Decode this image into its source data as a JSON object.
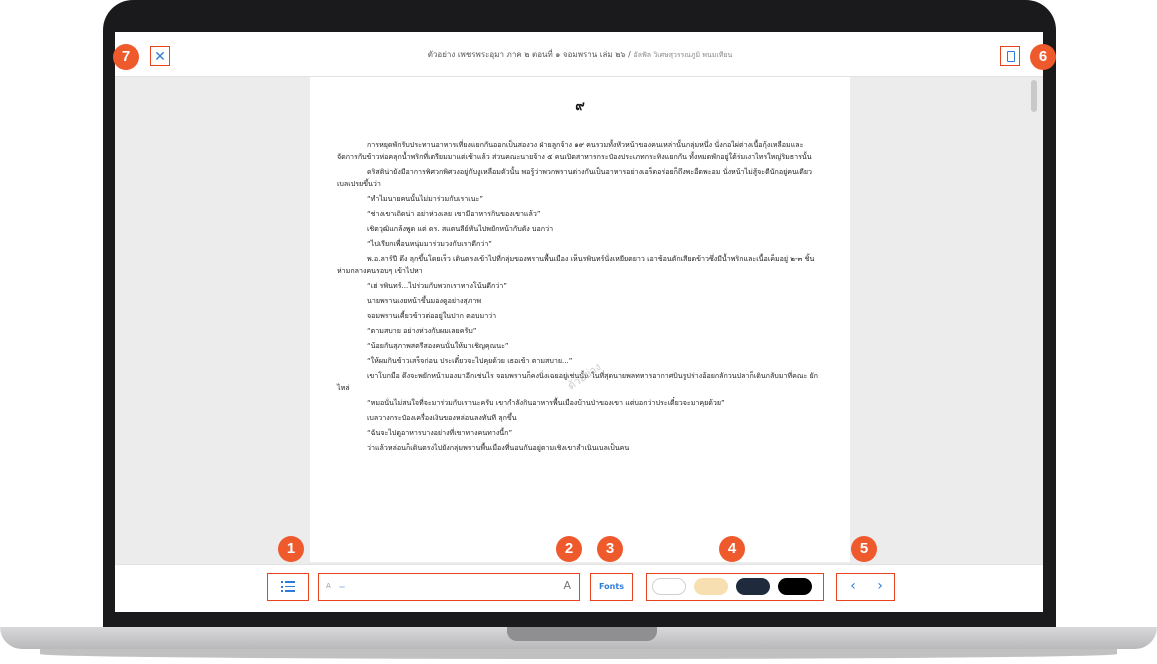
{
  "header": {
    "title": "ตัวอย่าง เพชรพระอุมา ภาค ๒ ตอนที่ ๑ จอมพราน เล่ม ๒๖ /",
    "author": "อัลฟัล วิเศษสุวรรณภูมิ พนมเทียน",
    "close_icon": "close-icon",
    "bookmark_icon": "bookmark-icon"
  },
  "page": {
    "number": "๙",
    "watermark": "ตัวอย่าง",
    "paragraphs": [
      "การหยุดพักรับประทานอาหารเที่ยงแยกกันออกเป็นสองวง ฝ่ายลูกจ้าง ๑๙ คนรวมทั้งหัวหน้าของคนเหล่านั้นกลุ่มหนึ่ง นั่งกอไผ่ต่างเนื้อกุ้งเหลือมและจัดการกับข้าวห่อคลุกน้ำพริกที่เตรียมมาแต่เช้าแล้ว ส่วนคณะนายจ้าง ๕ คนเปิดสาหารกระป๋องประเภทกระทิงแยกกัน ทั้งหมดพักอยู่ใต้ร่มเงาไทรใหญ่ริมธารนั้น",
      "ดริสติน่ายังมีอาการพิศวกพิศวงอยู่กับงูเหลือมตัวนั้น พอรู้ว่าพวกพรานต่างกันเป็นอาหารอย่างเอร็ดอร่อยก็ถึงพะอืดพะอม นั่งหน้าไม่สู้จะดีนักอยู่คนเดียว เบลเปรยขึ้นว่า",
      "“ทำไมนายคนนั้นไม่มาร่วมกับเราเนะ”",
      "“ช่างเขาเถิดน่า อย่าห่วงเลย เขามีอาหารกินของเขาแล้ว”",
      "เชิดวุฒิแกล้งพูด แต่ ดร. สแตนลีย์หันไปพยักหน้ากับดัง บอกว่า",
      "“ไปเรียกเพื่อนหนุ่มมาร่วมวงกับเราดีกว่า”",
      "พ.อ.ลาร์ปี ดึง ลุกขึ้นโดยเร็ว เดินตรงเข้าไปที่กลุ่มของพรานพื้นเมือง เห็นรพินทร์นั่งเหยียดยาว เอาช้อนตักเสียดข้าวซึ่งมีน้ำพริกและเนื้อเค็มอยู่ ๒-๓ ชิ้นห่ามกลางคนรอบๆ เข้าไปหา",
      "“เฮ่ รพินทร์...ไปร่วมกับพวกเราทางโน้นดีกว่า”",
      "นายพรานเงยหน้าขึ้นมองดูอย่างสุภาพ",
      "จอมพรานเคี้ยวข้าวต่ออยู่ในปาก ตอบมาว่า",
      "“ตามสบาย อย่างห่วงกับผมเลยครับ”",
      "“น้อยกันสุภาพสตรีสองคนนั่นให้มาเชิญคุณนะ”",
      "“ให้ผมกินข้าวเสร็จก่อน ประเดี๋ยวจะไปคุยด้วย เธอเข้า ตามสบาย...”",
      "เขาโบกมือ ดึงจะพยักหน้ามองมาอีกเช่นไร จอมพรานก็คงนิ่งเฉยอยู่เช่นนั้น ในที่สุดนายพลทหารอากาศบินรูปร่างอ้อยกลักวนปลาก็เดินกลับมาที่คณะ ยักไหล่",
      "“หมอนั่นไม่สนใจที่จะมาร่วมกับเรานะครับ เขากำลังกินอาหารพื้นเมืองบ้านป่าของเขา แต่บอกว่าประเดี๋ยวจะมาคุยด้วย”",
      "เบลวางกระป๋องเครื่องเงินของหล่อนลงทันที ลุกขึ้น",
      "“ฉันจะไปดูอาหารบางอย่างที่เขาทางคนทางนี้ก”",
      "ว่าแล้วหล่อนก็เดินตรงไปยังกลุ่มพรานพื้นเมืองที่นอนกันอยู่ตามเชิงเขาลำเนินเบลเป็นคน"
    ]
  },
  "toolbar": {
    "toc_icon": "list-icon",
    "font_small_label": "A",
    "font_large_label": "A",
    "fonts_label": "Fonts",
    "themes": [
      "white",
      "sepia",
      "navy",
      "black"
    ],
    "prev_label": "‹",
    "next_label": "›"
  },
  "colors": {
    "accent": "#2f7bd9",
    "callout": "#ef5a2d",
    "theme_white": "#ffffff",
    "theme_sepia": "#f7dfb2",
    "theme_navy": "#1f2b3c",
    "theme_black": "#000000"
  },
  "callouts": [
    "1",
    "2",
    "3",
    "4",
    "5",
    "6",
    "7"
  ]
}
